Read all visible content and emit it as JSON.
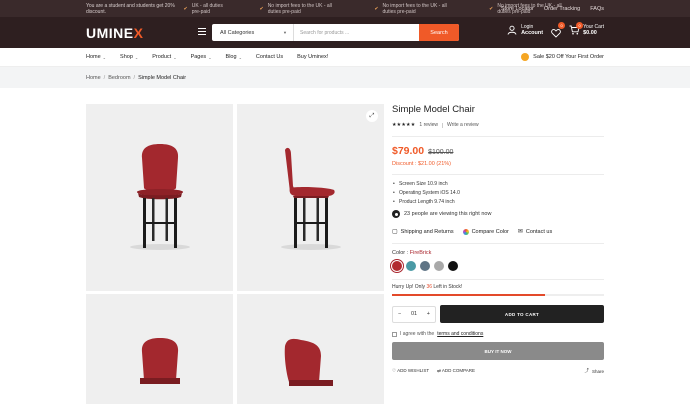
{
  "topbar": {
    "promo": "You are a student and students get 20% discount.",
    "shipping": [
      "UK - all duties pre-paid",
      "No import fees to the UK - all duties pre-paid",
      "No import fees to the UK - all duties pre-paid",
      "No import fees to the UK - all duties pre-paid"
    ],
    "links": [
      "Store Locator",
      "Order Tracking",
      "FAQs"
    ]
  },
  "header": {
    "logo_main": "UMINE",
    "logo_accent": "X",
    "search_category": "All Categories",
    "search_placeholder": "Search for products ...",
    "search_button": "Search",
    "login_label": "Login",
    "account_label": "Account",
    "wishlist_count": "0",
    "cart_count": "0",
    "cart_label": "Your Cart",
    "cart_total": "$0.00"
  },
  "nav": {
    "items": [
      {
        "label": "Home",
        "caret": true
      },
      {
        "label": "Shop",
        "caret": true
      },
      {
        "label": "Product",
        "caret": true
      },
      {
        "label": "Pages",
        "caret": true
      },
      {
        "label": "Blog",
        "caret": true
      },
      {
        "label": "Contact Us",
        "caret": false
      },
      {
        "label": "Buy Uminex!",
        "caret": false
      }
    ],
    "sale": "Sale $20 Off Your First Order"
  },
  "breadcrumb": [
    "Home",
    "Bedroom",
    "Simple Model Chair"
  ],
  "product": {
    "title": "Simple Model Chair",
    "stars": "★★★★★",
    "reviews": "1 review",
    "write_review": "Write a review",
    "price": "$79.00",
    "old_price": "$100.00",
    "discount": "Discount : $21.00 (21%)",
    "specs": [
      "Screen Size 10.9 inch",
      "Operating System iOS 14.0",
      "Product Length 9.74 inch"
    ],
    "viewing": "23 people are viewing this right now",
    "actions": [
      "Shipping and Returns",
      "Compare Color",
      "Contact us"
    ],
    "color_label": "Color : ",
    "color_value": "FireBrick",
    "swatches": [
      "#b22a2f",
      "#4a9aa5",
      "#5f7485",
      "#a9a9a9",
      "#111111"
    ],
    "hurry_prefix": "Hurry Up! Only ",
    "hurry_count": "36",
    "hurry_suffix": " Left in Stock!",
    "stock_fraction": 0.72,
    "quantity": "01",
    "add_to_cart": "ADD TO CART",
    "agree_prefix": "I agree with the ",
    "agree_link": "terms and conditions",
    "buy_now": "BUY IT NOW",
    "add_wishlist": "ADD WISHLIST",
    "add_compare": "ADD COMPARE",
    "share": "Share"
  },
  "colors": {
    "accent": "#f05a28",
    "topbar_bg": "#3a2a2b",
    "header_bg": "#2e1f20",
    "chair": "#a3282e"
  }
}
